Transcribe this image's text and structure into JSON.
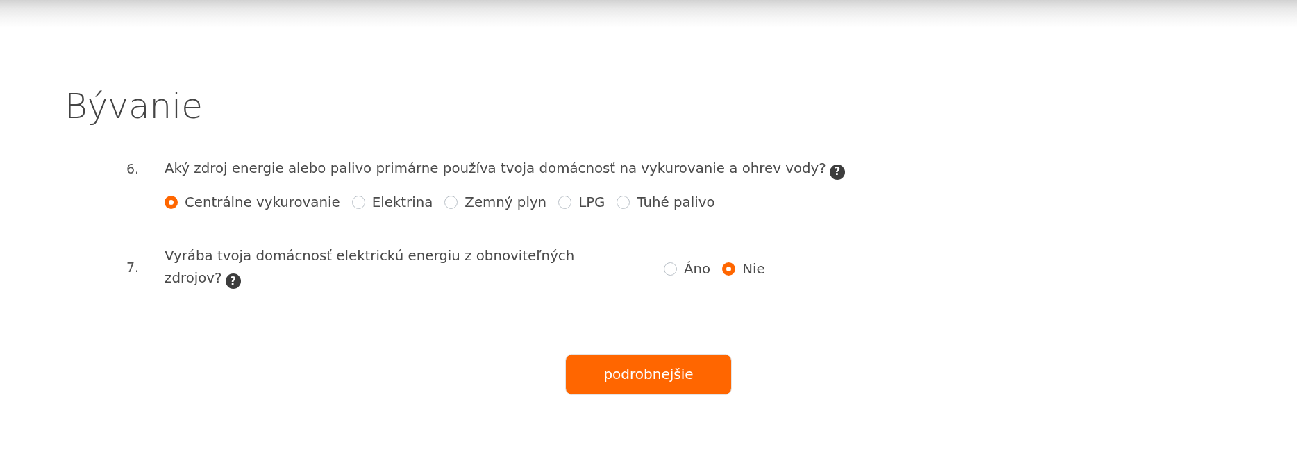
{
  "section": {
    "title": "Bývanie"
  },
  "questions": [
    {
      "number": "6.",
      "text": "Aký zdroj energie alebo palivo primárne používa tvoja domácnosť na vykurovanie a ohrev vody?",
      "help": "?",
      "kind": "stacked",
      "options": [
        {
          "label": "Centrálne vykurovanie",
          "selected": true
        },
        {
          "label": "Elektrina",
          "selected": false
        },
        {
          "label": "Zemný plyn",
          "selected": false
        },
        {
          "label": "LPG",
          "selected": false
        },
        {
          "label": "Tuhé palivo",
          "selected": false
        }
      ]
    },
    {
      "number": "7.",
      "text": "Vyrába tvoja domácnosť elektrickú energiu z obnoviteľných zdrojov?",
      "help": "?",
      "kind": "inline",
      "options": [
        {
          "label": "Áno",
          "selected": false
        },
        {
          "label": "Nie",
          "selected": true
        }
      ]
    }
  ],
  "button": {
    "label": "podrobnejšie"
  }
}
